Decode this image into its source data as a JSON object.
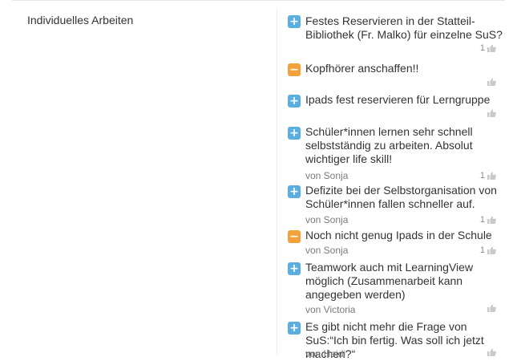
{
  "category": {
    "label": "Individuelles Arbeiten"
  },
  "colors": {
    "pro": "#5aaee0",
    "con": "#f3a13b",
    "thumb": "#c9c9c9"
  },
  "items": [
    {
      "type": "pro",
      "icon": "plus-icon",
      "symbol": "+",
      "text": "Festes Reservieren in der Statteil-Bibliothek (Fr. Malko) für einzelne SuS?",
      "author": "",
      "likes": "1"
    },
    {
      "type": "con",
      "icon": "minus-icon",
      "symbol": "−",
      "text": "Kopfhörer anschaffen!!",
      "author": "",
      "likes": ""
    },
    {
      "type": "pro",
      "icon": "plus-icon",
      "symbol": "+",
      "text": "Ipads fest reservieren für Lerngruppe",
      "author": "",
      "likes": ""
    },
    {
      "type": "pro",
      "icon": "plus-icon",
      "symbol": "+",
      "text": "Schüler*innen lernen sehr schnell selbstständig zu arbeiten. Absolut wichtiger life skill!",
      "author": "von Sonja",
      "likes": "1"
    },
    {
      "type": "pro",
      "icon": "plus-icon",
      "symbol": "+",
      "text": "Defizite bei der Selbstorganisation von Schüler*innen fallen schneller auf.",
      "author": "von Sonja",
      "likes": "1"
    },
    {
      "type": "con",
      "icon": "minus-icon",
      "symbol": "−",
      "text": "Noch nicht genug Ipads in der Schule",
      "author": "von Sonja",
      "likes": "1"
    },
    {
      "type": "pro",
      "icon": "plus-icon",
      "symbol": "+",
      "text": "Teamwork auch mit LearningView möglich (Zusammenarbeit kann angegeben werden)",
      "author": "von Victoria",
      "likes": ""
    },
    {
      "type": "pro",
      "icon": "plus-icon",
      "symbol": "+",
      "text": "Es gibt nicht mehr die Frage von SuS:“Ich bin fertig. Was soll ich jetzt machen?“",
      "author": "von Heidi",
      "likes": ""
    }
  ]
}
